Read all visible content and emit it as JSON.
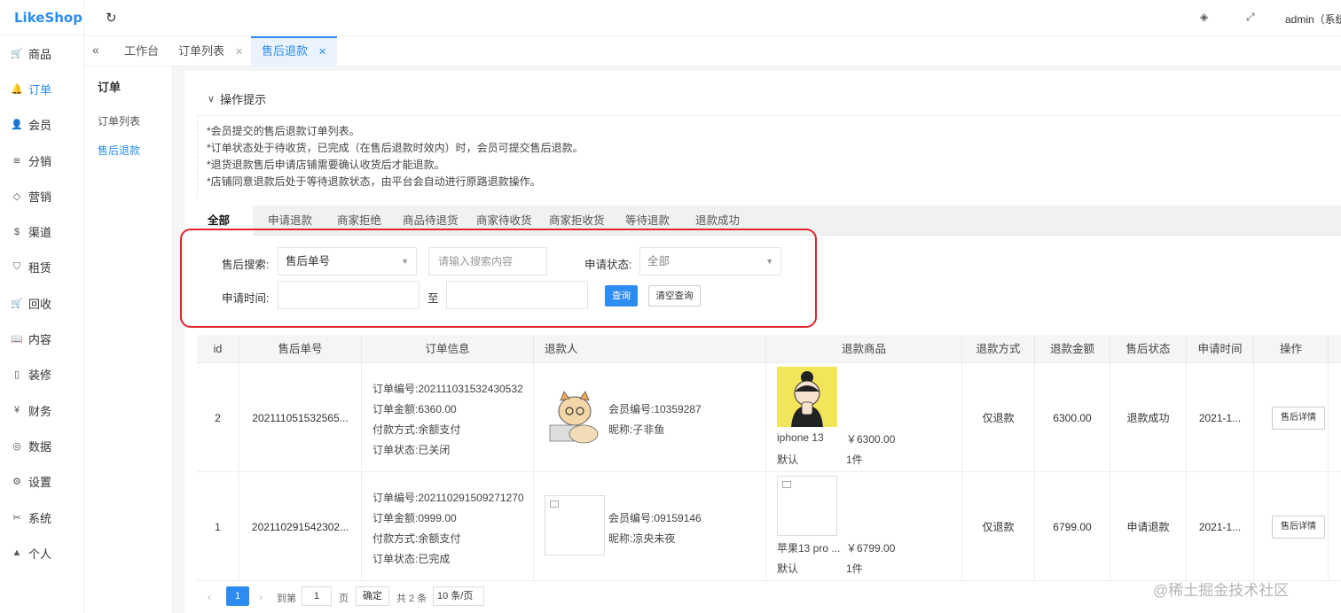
{
  "app": {
    "logo": "LikeShop",
    "admin": "admin（系统"
  },
  "icons": {
    "refresh": "refresh-icon",
    "tag": "tag-icon",
    "fullscreen": "fullscreen-icon",
    "collapse": "collapse-icon"
  },
  "nav": [
    {
      "label": "商品",
      "icon": "cart-icon",
      "glyph": "🛒"
    },
    {
      "label": "订单",
      "icon": "bell-icon",
      "glyph": "🔔"
    },
    {
      "label": "会员",
      "icon": "user-icon",
      "glyph": "👤"
    },
    {
      "label": "分销",
      "icon": "layers-icon",
      "glyph": "≋"
    },
    {
      "label": "营销",
      "icon": "diamond-icon",
      "glyph": "◇"
    },
    {
      "label": "渠道",
      "icon": "dollar-icon",
      "glyph": "$"
    },
    {
      "label": "租赁",
      "icon": "shield-icon",
      "glyph": "⛉"
    },
    {
      "label": "回收",
      "icon": "cart-icon",
      "glyph": "🛒"
    },
    {
      "label": "内容",
      "icon": "book-icon",
      "glyph": "📖"
    },
    {
      "label": "装修",
      "icon": "phone-icon",
      "glyph": "▯"
    },
    {
      "label": "财务",
      "icon": "yen-icon",
      "glyph": "¥"
    },
    {
      "label": "数据",
      "icon": "globe-icon",
      "glyph": "◎"
    },
    {
      "label": "设置",
      "icon": "gear-icon",
      "glyph": "⚙"
    },
    {
      "label": "系统",
      "icon": "tool-icon",
      "glyph": "✂"
    },
    {
      "label": "个人",
      "icon": "person-icon",
      "glyph": "▲"
    }
  ],
  "tabs": [
    {
      "label": "工作台",
      "closable": false
    },
    {
      "label": "订单列表",
      "closable": true
    },
    {
      "label": "售后退款",
      "closable": true,
      "active": true
    }
  ],
  "subnav": {
    "title": "订单",
    "items": [
      "订单列表",
      "售后退款"
    ]
  },
  "tips": {
    "title": "操作提示",
    "lines": [
      "*会员提交的售后退款订单列表。",
      "*订单状态处于待收货，已完成（在售后退款时效内）时，会员可提交售后退款。",
      "*退货退款售后申请店铺需要确认收货后才能退款。",
      "*店铺同意退款后处于等待退款状态，由平台会自动进行原路退款操作。"
    ]
  },
  "status_tabs": [
    "全部",
    "申请退款",
    "商家拒绝",
    "商品待退货",
    "商家待收货",
    "商家拒收货",
    "等待退款",
    "退款成功"
  ],
  "filters": {
    "search_label": "售后搜索:",
    "search_type": "售后单号",
    "search_placeholder": "请输入搜索内容",
    "status_label": "申请状态:",
    "status_value": "全部",
    "time_label": "申请时间:",
    "to": "至",
    "query": "查询",
    "clear": "清空查询"
  },
  "table": {
    "headers": [
      "id",
      "售后单号",
      "订单信息",
      "退款人",
      "退款商品",
      "退款方式",
      "退款金额",
      "售后状态",
      "申请时间",
      "操作"
    ],
    "rows": [
      {
        "id": "2",
        "sn": "202111051532565...",
        "order_sn": "订单编号:202111031532430532",
        "order_amount": "订单金额:6360.00",
        "pay_way": "付款方式:余额支付",
        "order_status": "订单状态:已关闭",
        "member_sn": "会员编号:10359287",
        "nickname": "昵称:子非鱼",
        "goods_name": "iphone 13",
        "goods_price": "￥6300.00",
        "goods_spec": "默认",
        "goods_num": "1件",
        "refund_way": "仅退款",
        "refund_amount": "6300.00",
        "status": "退款成功",
        "time": "2021-1...",
        "op": "售后详情"
      },
      {
        "id": "1",
        "sn": "202110291542302...",
        "order_sn": "订单编号:202110291509271270",
        "order_amount": "订单金额:0999.00",
        "pay_way": "付款方式:余额支付",
        "order_status": "订单状态:已完成",
        "member_sn": "会员编号:09159146",
        "nickname": "昵称:凉央未夜",
        "goods_name": "苹果13 pro ...",
        "goods_price": "￥6799.00",
        "goods_spec": "默认",
        "goods_num": "1件",
        "refund_way": "仅退款",
        "refund_amount": "6799.00",
        "status": "申请退款",
        "time": "2021-1...",
        "op": "售后详情"
      }
    ]
  },
  "pager": {
    "page": "1",
    "goto": "到第",
    "input": "1",
    "unit": "页",
    "confirm": "确定",
    "total": "共 2 条",
    "size": "10 条/页"
  },
  "watermark": "@稀土掘金技术社区",
  "colors": {
    "primary": "#2d8cf0",
    "highlight_border": "#e2232a"
  }
}
